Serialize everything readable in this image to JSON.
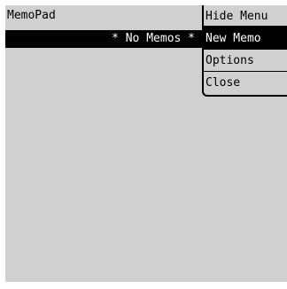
{
  "app": {
    "title": "MemoPad"
  },
  "list": {
    "rows": [
      {
        "text": "* No Memos *",
        "selected": true
      }
    ]
  },
  "menu": {
    "items": [
      {
        "label": "Hide Menu"
      },
      {
        "label": "New Memo",
        "selected": true
      },
      {
        "label": "Options"
      },
      {
        "label": "Close"
      }
    ]
  },
  "colors": {
    "screen_bg": "#d0d0d0",
    "highlight_bg": "#000000",
    "highlight_fg": "#ffffff"
  }
}
